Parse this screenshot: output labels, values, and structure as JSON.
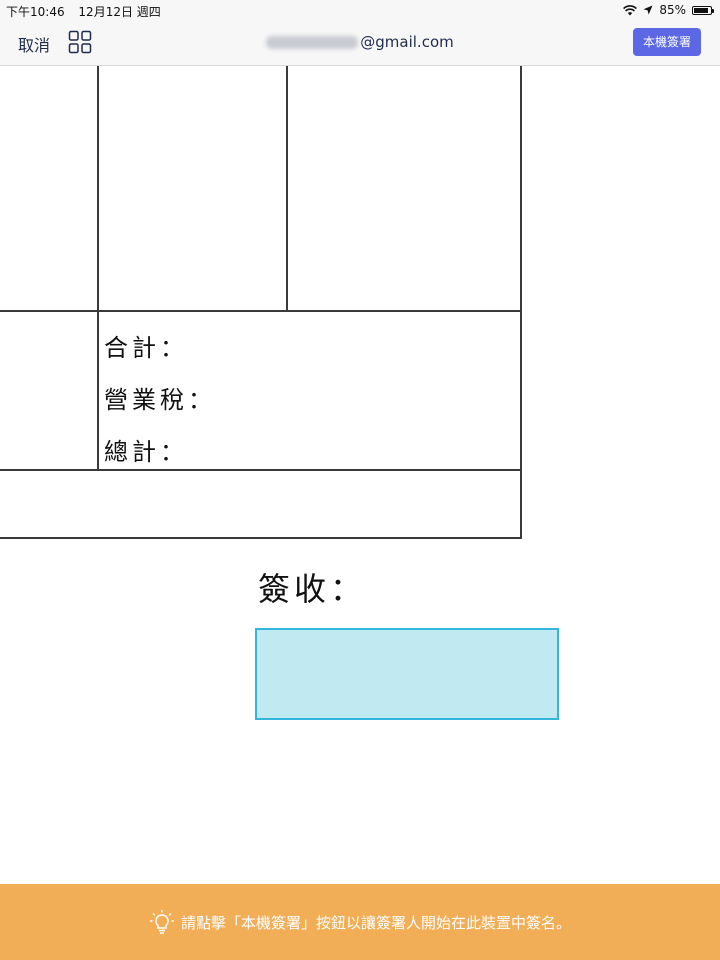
{
  "status_bar": {
    "time": "下午10:46",
    "date": "12月12日 週四",
    "battery": "85%",
    "battery_level": 0.85
  },
  "nav": {
    "cancel_label": "取消",
    "email_suffix": "@gmail.com",
    "local_sign_label": "本機簽署"
  },
  "document": {
    "subtotal_label": "合計：",
    "tax_label": "營業稅：",
    "total_label": "總計：",
    "receipt_label": "簽收："
  },
  "banner": {
    "message": "請點擊「本機簽署」按鈕以讓簽署人開始在此裝置中簽名。"
  },
  "colors": {
    "accent": "#5b67e5",
    "banner": "#f2ae56",
    "signature_field": "#c1e9f2",
    "signature_border": "#33b6dc"
  }
}
